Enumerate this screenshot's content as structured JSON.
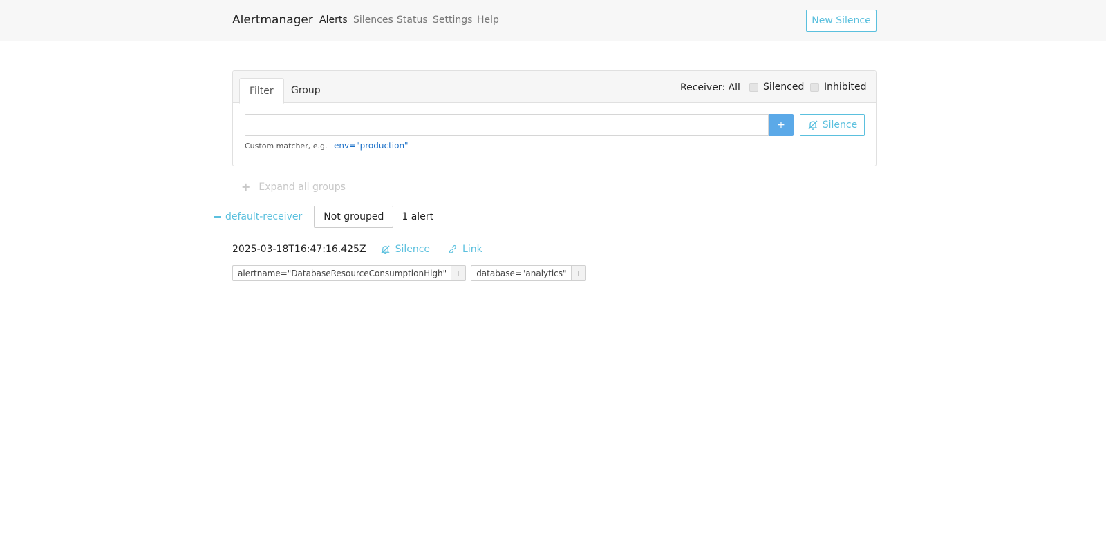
{
  "navbar": {
    "brand": "Alertmanager",
    "links": [
      "Alerts",
      "Silences",
      "Status",
      "Settings",
      "Help"
    ],
    "new_silence": "New Silence"
  },
  "filter_card": {
    "tabs": [
      "Filter",
      "Group"
    ],
    "receiver": "Receiver: All",
    "silenced": "Silenced",
    "inhibited": "Inhibited",
    "input_value": "",
    "plus": "+",
    "silence_button": "Silence",
    "hint_prefix": "Custom matcher, e.g.",
    "hint_example": "env=\"production\""
  },
  "expand_all": "Expand all groups",
  "group": {
    "receiver": "default-receiver",
    "grouping": "Not grouped",
    "count": "1 alert"
  },
  "alert": {
    "timestamp": "2025-03-18T16:47:16.425Z",
    "silence": "Silence",
    "link": "Link",
    "labels": [
      {
        "text": "alertname=\"DatabaseResourceConsumptionHigh\"",
        "add": "+"
      },
      {
        "text": "database=\"analytics\"",
        "add": "+"
      }
    ]
  },
  "colors": {
    "accent": "#5bc0de",
    "primary": "#5ba9e8"
  }
}
